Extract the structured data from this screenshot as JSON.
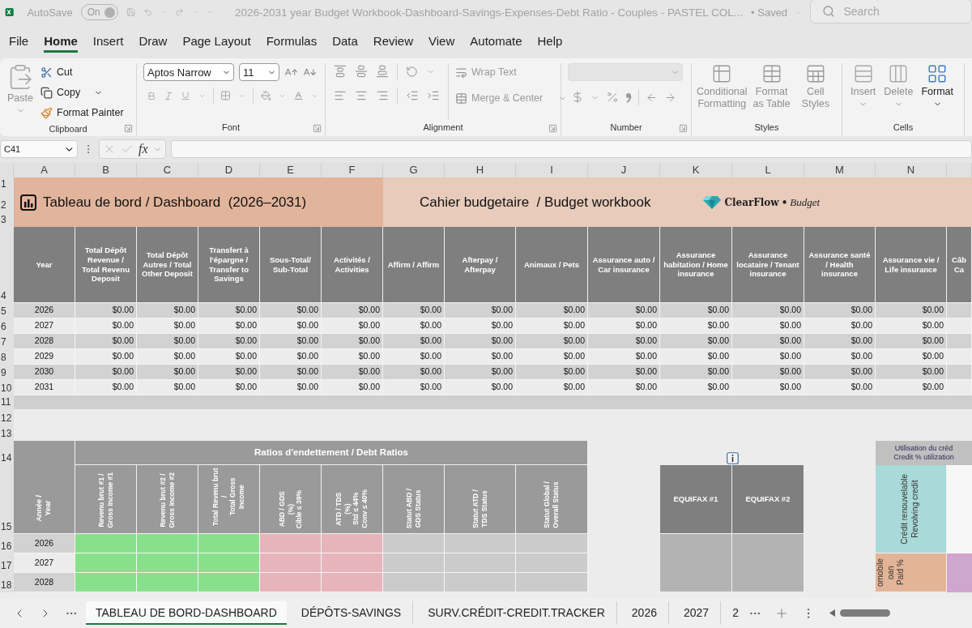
{
  "title_bar": {
    "autosave": "AutoSave",
    "autosave_toggle": {
      "label": "On",
      "on": true
    },
    "document_title": "2026-2031 year Budget Workbook-Dashboard-Savings-Expenses-Debt Ratio - Couples - PASTEL COL...",
    "save_status": "• Saved",
    "search": {
      "placeholder": "Search"
    }
  },
  "menu_tabs": [
    {
      "label": "File",
      "selected": false
    },
    {
      "label": "Home",
      "selected": true
    },
    {
      "label": "Insert",
      "selected": false
    },
    {
      "label": "Draw",
      "selected": false
    },
    {
      "label": "Page Layout",
      "selected": false
    },
    {
      "label": "Formulas",
      "selected": false
    },
    {
      "label": "Data",
      "selected": false
    },
    {
      "label": "Review",
      "selected": false
    },
    {
      "label": "View",
      "selected": false
    },
    {
      "label": "Automate",
      "selected": false
    },
    {
      "label": "Help",
      "selected": false
    }
  ],
  "ribbon": {
    "clipboard": {
      "paste": "Paste",
      "cut": "Cut",
      "copy": "Copy",
      "format_painter": "Format Painter",
      "label": "Clipboard"
    },
    "font": {
      "font_name": "Aptos Narrow",
      "font_size": "11",
      "label": "Font"
    },
    "alignment": {
      "wrap_text": "Wrap Text",
      "merge_center": "Merge & Center",
      "label": "Alignment"
    },
    "number": {
      "label": "Number"
    },
    "styles": {
      "buttons": [
        {
          "label": "Conditional Formatting",
          "disabled": true
        },
        {
          "label": "Format as Table",
          "disabled": true
        },
        {
          "label": "Cell Styles",
          "disabled": true
        }
      ],
      "label": "Styles"
    },
    "cells": {
      "buttons": [
        {
          "label": "Insert",
          "disabled": true
        },
        {
          "label": "Delete",
          "disabled": true
        },
        {
          "label": "Format",
          "disabled": false
        }
      ],
      "label": "Cells"
    }
  },
  "formula_bar": {
    "name_box": "C41",
    "function_label": "fx"
  },
  "column_headers": [
    "A",
    "B",
    "C",
    "D",
    "E",
    "F",
    "G",
    "H",
    "I",
    "J",
    "K",
    "L",
    "M",
    "N"
  ],
  "row_headers": [
    "1",
    "2",
    "3",
    "4",
    "5",
    "6",
    "7",
    "8",
    "9",
    "10",
    "11",
    "12",
    "13",
    "14",
    "15",
    "16",
    "17",
    "18"
  ],
  "dashboard_header": {
    "title": "Tableau de bord / Dashboard  (2026–2031)",
    "subtitle": "Cahier budgetaire  / Budget workbook",
    "logo": {
      "name": "ClearFlow",
      "separator": "•",
      "tagline": "Budget"
    }
  },
  "summary_table": {
    "columns": [
      "Year",
      "Total Dépôt Revenue / Total Revenu Deposit",
      "Total Dépôt Autres / Total Other Deposit",
      "Transfert à l'épargne / Transfer to Savings",
      "Sous-Total/ Sub-Total",
      "Activités / Activities",
      "Affirm / Affirm",
      "Afterpay / Afterpay",
      "Animaux / Pets",
      "Assurance auto / Car insurance",
      "Assurance habitation / Home insurance",
      "Assurance locataire / Tenant insurance",
      "Assurance santé / Health insurance",
      "Assurance vie / Life insurance",
      "Câb Ca"
    ],
    "rows": [
      {
        "year": "2026",
        "values": [
          "$0.00",
          "$0.00",
          "$0.00",
          "$0.00",
          "$0.00",
          "$0.00",
          "$0.00",
          "$0.00",
          "$0.00",
          "$0.00",
          "$0.00",
          "$0.00",
          "$0.00"
        ]
      },
      {
        "year": "2027",
        "values": [
          "$0.00",
          "$0.00",
          "$0.00",
          "$0.00",
          "$0.00",
          "$0.00",
          "$0.00",
          "$0.00",
          "$0.00",
          "$0.00",
          "$0.00",
          "$0.00",
          "$0.00"
        ]
      },
      {
        "year": "2028",
        "values": [
          "$0.00",
          "$0.00",
          "$0.00",
          "$0.00",
          "$0.00",
          "$0.00",
          "$0.00",
          "$0.00",
          "$0.00",
          "$0.00",
          "$0.00",
          "$0.00",
          "$0.00"
        ]
      },
      {
        "year": "2029",
        "values": [
          "$0.00",
          "$0.00",
          "$0.00",
          "$0.00",
          "$0.00",
          "$0.00",
          "$0.00",
          "$0.00",
          "$0.00",
          "$0.00",
          "$0.00",
          "$0.00",
          "$0.00"
        ]
      },
      {
        "year": "2030",
        "values": [
          "$0.00",
          "$0.00",
          "$0.00",
          "$0.00",
          "$0.00",
          "$0.00",
          "$0.00",
          "$0.00",
          "$0.00",
          "$0.00",
          "$0.00",
          "$0.00",
          "$0.00"
        ]
      },
      {
        "year": "2031",
        "values": [
          "$0.00",
          "$0.00",
          "$0.00",
          "$0.00",
          "$0.00",
          "$0.00",
          "$0.00",
          "$0.00",
          "$0.00",
          "$0.00",
          "$0.00",
          "$0.00",
          "$0.00"
        ]
      }
    ]
  },
  "debt_ratios": {
    "title": "Ratios d'endettement / Debt Ratios",
    "year_column": "Année /\nYear",
    "columns": [
      {
        "label": "Revenu brut #1 /\nGross Income #1",
        "color": "#88e08c"
      },
      {
        "label": "Revenu brut #2 /\nGross Income #2",
        "color": "#88e08c"
      },
      {
        "label": "Total Revenu brut\n/\nTotal Gross Income",
        "color": "#88e08c"
      },
      {
        "label": "ABD / GDS\n(%)\nCible ≤ 39%",
        "color": "#e8b4bc"
      },
      {
        "label": "ATD / TDS\n(%)\nStd ≤ 44%\nConv ≤ 40%",
        "color": "#e8b4bc"
      },
      {
        "label": "Statut ABD /\nGDS Status",
        "color": "#cbcbcb"
      },
      {
        "label": "Statut ATD /\nTDS Status",
        "color": "#cbcbcb"
      },
      {
        "label": "Statut Global /\nOverall Status",
        "color": "#cbcbcb"
      }
    ],
    "rows": [
      {
        "year": "2026"
      },
      {
        "year": "2027"
      },
      {
        "year": "2028"
      }
    ]
  },
  "credit_scores": {
    "columns": [
      "EQUIFAX #1",
      "EQUIFAX #2"
    ]
  },
  "credit_utilization": {
    "title": "Utilisation du créd\nCredit % utilization",
    "cells": [
      {
        "label": "Crédit renouvelable\nRevolving credit",
        "color": "#a9d9d8"
      },
      {
        "label": "omobile\noan\nPaid %",
        "color": "#e3b497"
      }
    ]
  },
  "sheet_tabs": [
    {
      "label": "TABLEAU DE BORD-DASHBOARD",
      "selected": true
    },
    {
      "label": "DÉPÔTS-SAVINGS",
      "selected": false
    },
    {
      "label": "SURV.CRÉDIT-CREDIT.TRACKER",
      "selected": false
    },
    {
      "label": "2026",
      "selected": false
    },
    {
      "label": "2027",
      "selected": false
    },
    {
      "label": "2",
      "selected": false
    }
  ]
}
